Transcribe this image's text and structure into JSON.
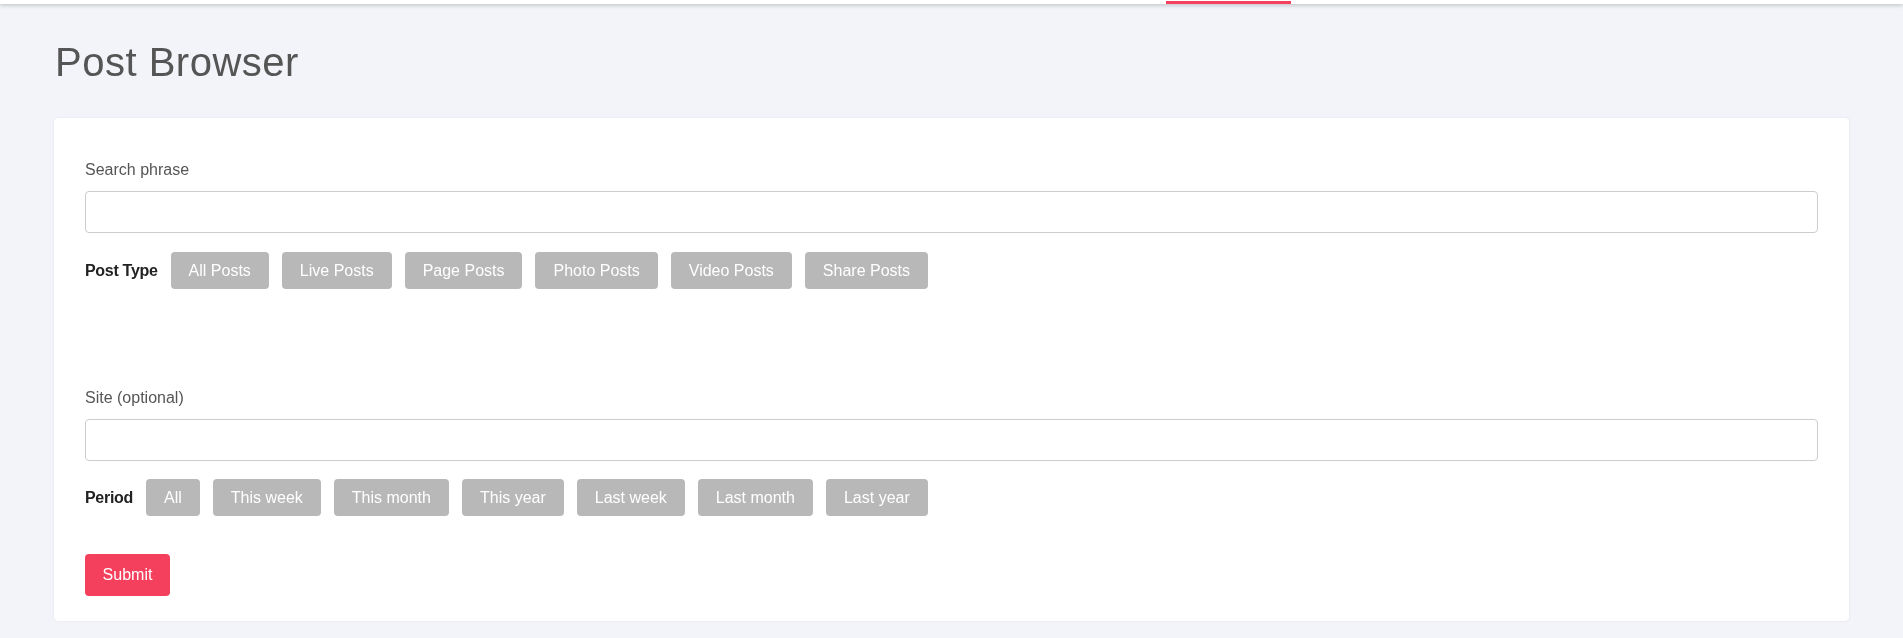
{
  "page_title": "Post Browser",
  "search": {
    "label": "Search phrase"
  },
  "post_type": {
    "label": "Post Type",
    "options": [
      {
        "label": "All Posts",
        "selected": false
      },
      {
        "label": "Live Posts",
        "selected": false
      },
      {
        "label": "Page Posts",
        "selected": false
      },
      {
        "label": "Photo Posts",
        "selected": false
      },
      {
        "label": "Video Posts",
        "selected": false
      },
      {
        "label": "Share Posts",
        "selected": false
      }
    ]
  },
  "site": {
    "label": "Site (optional)"
  },
  "period": {
    "label": "Period",
    "options": [
      {
        "label": "All",
        "selected": false
      },
      {
        "label": "This week",
        "selected": false
      },
      {
        "label": "This month",
        "selected": false
      },
      {
        "label": "This year",
        "selected": false
      },
      {
        "label": "Last week",
        "selected": false
      },
      {
        "label": "Last month",
        "selected": false
      },
      {
        "label": "Last year",
        "selected": false
      }
    ]
  },
  "submit": "Submit"
}
